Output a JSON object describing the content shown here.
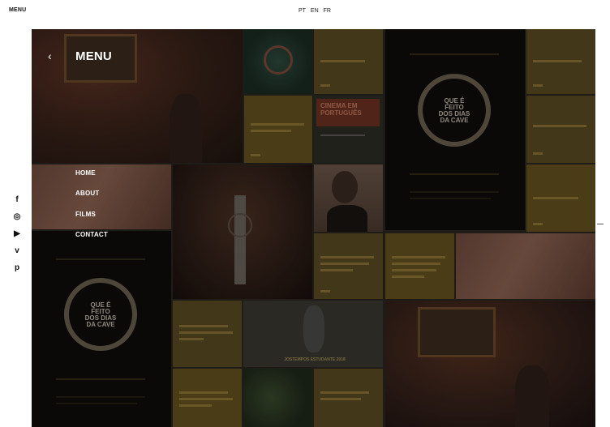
{
  "topbar": {
    "menu_label": "MENU",
    "languages": [
      "PT",
      "EN",
      "FR"
    ]
  },
  "menu": {
    "title": "MENU",
    "back_icon": "chevron-left-icon",
    "items": [
      "HOME",
      "ABOUT",
      "FILMS",
      "CONTACT"
    ]
  },
  "social": [
    {
      "name": "facebook-icon",
      "glyph": "f"
    },
    {
      "name": "instagram-icon",
      "glyph": "◎"
    },
    {
      "name": "youtube-icon",
      "glyph": "▶"
    },
    {
      "name": "vimeo-icon",
      "glyph": "v"
    },
    {
      "name": "pinterest-icon",
      "glyph": "p"
    }
  ],
  "tiles": {
    "poster_logo_text": "QUE É FEITO DOS DIAS DA CAVE",
    "cinema_card": "CINEMA EM PORTUGUÊS",
    "festival_poster_caption": "JOSTEMPOS ESTUDANTE 2018"
  },
  "colors": {
    "background": "#ffffff",
    "grid_bg": "#2a241f",
    "mustard": "#5a4a22",
    "menu_text": "#ffffff"
  }
}
